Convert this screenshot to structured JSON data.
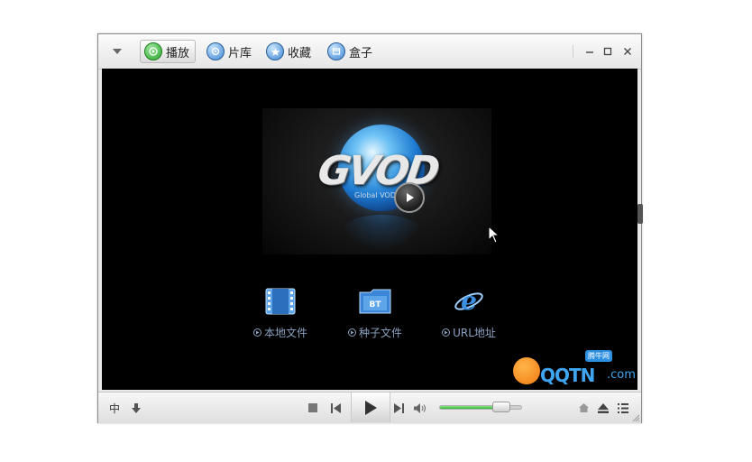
{
  "header": {
    "tabs": [
      {
        "label": "播放",
        "icon": "play-tab-icon",
        "active": true
      },
      {
        "label": "片库",
        "icon": "library-tab-icon",
        "active": false
      },
      {
        "label": "收藏",
        "icon": "favorites-star-icon",
        "active": false
      },
      {
        "label": "盒子",
        "icon": "box-tab-icon",
        "active": false
      }
    ],
    "window_controls": [
      "minimize-icon",
      "maximize-icon",
      "close-icon"
    ]
  },
  "splash": {
    "brand": "GVOD",
    "brand_sub": "Global VOD"
  },
  "shortcuts": [
    {
      "label": "本地文件",
      "icon": "film-strip-icon"
    },
    {
      "label": "种子文件",
      "icon": "bt-folder-icon",
      "badge": "BT"
    },
    {
      "label": "URL地址",
      "icon": "ie-browser-icon"
    }
  ],
  "watermark": {
    "text": "QQTN",
    "suffix": ".com",
    "badge": "腾牛网"
  },
  "controlbar": {
    "lang_label": "中",
    "volume_level": 0.75
  },
  "colors": {
    "accent_green": "#2fb52f",
    "link_blue": "#8aa2c0",
    "watermark_blue": "#3fa5f0",
    "video_bg": "#000000"
  }
}
